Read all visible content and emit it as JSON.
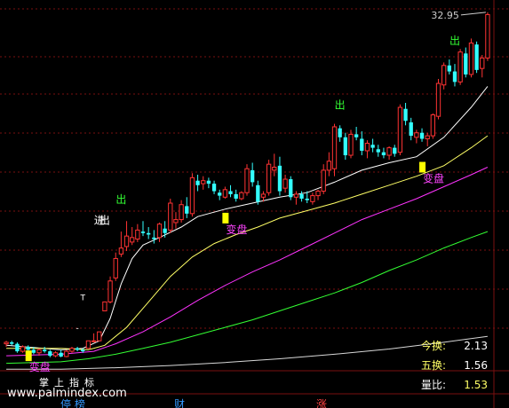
{
  "chart_data": {
    "type": "candlestick",
    "price_max_label": "32.95",
    "ylim": [
      9.0,
      33.3
    ],
    "up_color": "#ff3333",
    "down_color": "#33ffff",
    "bg_color": "#000000",
    "grid_color": "#7a1010",
    "candles": [
      [
        10.8,
        11.0,
        10.6,
        10.9
      ],
      [
        10.9,
        11.0,
        10.7,
        10.8
      ],
      [
        10.8,
        10.9,
        10.2,
        10.3
      ],
      [
        10.3,
        10.7,
        10.2,
        10.6
      ],
      [
        10.6,
        10.7,
        10.3,
        10.4
      ],
      [
        10.4,
        10.6,
        10.1,
        10.2
      ],
      [
        10.2,
        10.5,
        10.0,
        10.4
      ],
      [
        10.4,
        10.6,
        10.2,
        10.3
      ],
      [
        10.3,
        10.4,
        9.9,
        10.0
      ],
      [
        10.0,
        10.3,
        9.9,
        10.2
      ],
      [
        10.2,
        10.4,
        9.9,
        9.95
      ],
      [
        9.95,
        10.4,
        9.9,
        10.3
      ],
      [
        10.3,
        10.6,
        10.2,
        10.5
      ],
      [
        10.5,
        10.6,
        10.3,
        10.4
      ],
      [
        10.4,
        10.5,
        10.2,
        10.3
      ],
      [
        10.5,
        11.0,
        10.5,
        11.0
      ],
      [
        11.0,
        11.5,
        10.9,
        11.0
      ],
      [
        11.0,
        11.6,
        11.0,
        11.6
      ],
      [
        13.0,
        13.6,
        13.0,
        13.6
      ],
      [
        13.6,
        15.3,
        13.5,
        15.0
      ],
      [
        15.2,
        16.9,
        15.0,
        16.5
      ],
      [
        16.8,
        18.3,
        16.6,
        17.2
      ],
      [
        17.3,
        19.0,
        17.0,
        18.0
      ],
      [
        17.6,
        18.6,
        17.4,
        17.9
      ],
      [
        17.8,
        18.8,
        17.6,
        18.4
      ],
      [
        18.3,
        19.0,
        18.0,
        18.2
      ],
      [
        18.2,
        18.6,
        17.8,
        18.1
      ],
      [
        17.9,
        18.4,
        17.5,
        17.8
      ],
      [
        17.9,
        18.9,
        17.6,
        18.8
      ],
      [
        18.5,
        19.0,
        17.9,
        18.2
      ],
      [
        18.4,
        20.5,
        18.2,
        20.2
      ],
      [
        18.9,
        19.6,
        18.5,
        19.1
      ],
      [
        19.1,
        20.4,
        18.9,
        20.1
      ],
      [
        20.0,
        20.6,
        19.2,
        19.5
      ],
      [
        19.5,
        22.2,
        19.3,
        21.9
      ],
      [
        21.7,
        22.1,
        21.0,
        21.4
      ],
      [
        21.5,
        22.0,
        21.1,
        21.7
      ],
      [
        21.7,
        21.9,
        21.2,
        21.5
      ],
      [
        21.5,
        21.7,
        20.8,
        21.0
      ],
      [
        20.9,
        21.1,
        20.4,
        20.7
      ],
      [
        20.6,
        21.3,
        20.5,
        21.1
      ],
      [
        21.0,
        21.4,
        20.6,
        20.8
      ],
      [
        20.8,
        21.1,
        20.3,
        20.5
      ],
      [
        20.5,
        21.0,
        20.4,
        20.9
      ],
      [
        20.9,
        22.8,
        20.7,
        22.5
      ],
      [
        22.4,
        22.9,
        21.3,
        21.6
      ],
      [
        21.4,
        21.7,
        20.1,
        20.3
      ],
      [
        20.6,
        21.0,
        20.3,
        20.8
      ],
      [
        20.9,
        23.1,
        20.7,
        22.8
      ],
      [
        22.4,
        23.5,
        22.0,
        22.6
      ],
      [
        22.7,
        23.3,
        20.7,
        21.0
      ],
      [
        21.2,
        22.1,
        20.9,
        21.8
      ],
      [
        21.8,
        22.0,
        20.4,
        20.6
      ],
      [
        20.6,
        21.0,
        20.1,
        20.8
      ],
      [
        20.8,
        21.0,
        20.3,
        20.5
      ],
      [
        20.5,
        21.0,
        20.2,
        20.4
      ],
      [
        20.3,
        20.9,
        20.1,
        20.7
      ],
      [
        20.7,
        21.1,
        20.4,
        21.0
      ],
      [
        21.0,
        22.8,
        20.8,
        22.4
      ],
      [
        22.4,
        23.6,
        22.0,
        23.0
      ],
      [
        22.5,
        25.5,
        22.0,
        25.3
      ],
      [
        25.2,
        25.4,
        24.3,
        24.6
      ],
      [
        24.6,
        24.9,
        23.1,
        23.4
      ],
      [
        23.4,
        25.1,
        23.2,
        24.8
      ],
      [
        24.8,
        25.3,
        24.4,
        24.6
      ],
      [
        24.5,
        25.0,
        23.4,
        23.7
      ],
      [
        23.7,
        24.4,
        23.2,
        24.2
      ],
      [
        24.1,
        24.5,
        23.6,
        23.9
      ],
      [
        23.8,
        24.1,
        23.3,
        23.6
      ],
      [
        23.6,
        23.9,
        23.2,
        23.4
      ],
      [
        23.4,
        24.0,
        23.1,
        23.9
      ],
      [
        23.9,
        24.1,
        23.3,
        23.5
      ],
      [
        23.6,
        26.8,
        23.4,
        26.6
      ],
      [
        26.5,
        26.9,
        25.4,
        25.7
      ],
      [
        25.6,
        25.9,
        24.4,
        24.7
      ],
      [
        24.6,
        25.1,
        24.2,
        24.9
      ],
      [
        24.9,
        25.2,
        24.3,
        24.5
      ],
      [
        24.5,
        24.9,
        24.0,
        24.7
      ],
      [
        24.7,
        26.2,
        24.5,
        26.1
      ],
      [
        26.0,
        28.5,
        25.8,
        28.2
      ],
      [
        28.1,
        29.6,
        27.8,
        29.4
      ],
      [
        29.4,
        29.8,
        28.8,
        29.0
      ],
      [
        29.0,
        29.5,
        28.0,
        28.3
      ],
      [
        28.3,
        30.5,
        28.1,
        30.3
      ],
      [
        30.2,
        30.6,
        28.6,
        28.8
      ],
      [
        28.8,
        31.2,
        28.6,
        30.9
      ],
      [
        30.8,
        31.0,
        28.9,
        29.1
      ],
      [
        29.2,
        30.1,
        28.6,
        29.9
      ],
      [
        29.9,
        32.95,
        29.7,
        32.8
      ]
    ],
    "ma_lines": [
      {
        "color": "#ffffff",
        "points": [
          [
            0,
            10.7
          ],
          [
            10,
            10.4
          ],
          [
            14,
            10.5
          ],
          [
            17,
            11.0
          ],
          [
            19,
            12.5
          ],
          [
            21,
            14.8
          ],
          [
            23,
            16.5
          ],
          [
            25,
            17.4
          ],
          [
            28,
            17.9
          ],
          [
            32,
            18.6
          ],
          [
            35,
            19.3
          ],
          [
            40,
            19.8
          ],
          [
            45,
            20.2
          ],
          [
            50,
            20.6
          ],
          [
            55,
            20.9
          ],
          [
            60,
            21.6
          ],
          [
            65,
            22.4
          ],
          [
            70,
            22.9
          ],
          [
            75,
            23.3
          ],
          [
            80,
            24.6
          ],
          [
            85,
            26.6
          ],
          [
            88,
            28.0
          ]
        ]
      },
      {
        "color": "#ffff66",
        "points": [
          [
            0,
            10.5
          ],
          [
            10,
            10.5
          ],
          [
            15,
            10.4
          ],
          [
            18,
            10.7
          ],
          [
            22,
            11.9
          ],
          [
            26,
            13.6
          ],
          [
            30,
            15.3
          ],
          [
            34,
            16.6
          ],
          [
            38,
            17.5
          ],
          [
            42,
            18.1
          ],
          [
            46,
            18.6
          ],
          [
            50,
            19.2
          ],
          [
            55,
            19.7
          ],
          [
            60,
            20.2
          ],
          [
            65,
            20.8
          ],
          [
            70,
            21.4
          ],
          [
            75,
            22.0
          ],
          [
            80,
            22.7
          ],
          [
            85,
            23.9
          ],
          [
            88,
            24.7
          ]
        ]
      },
      {
        "color": "#ff33ff",
        "points": [
          [
            0,
            10.0
          ],
          [
            10,
            10.1
          ],
          [
            16,
            10.3
          ],
          [
            20,
            10.8
          ],
          [
            25,
            11.6
          ],
          [
            30,
            12.6
          ],
          [
            35,
            13.7
          ],
          [
            40,
            14.7
          ],
          [
            45,
            15.6
          ],
          [
            50,
            16.4
          ],
          [
            55,
            17.3
          ],
          [
            60,
            18.2
          ],
          [
            65,
            19.1
          ],
          [
            70,
            19.8
          ],
          [
            75,
            20.5
          ],
          [
            80,
            21.3
          ],
          [
            85,
            22.1
          ],
          [
            88,
            22.6
          ]
        ]
      },
      {
        "color": "#33ff33",
        "points": [
          [
            0,
            9.5
          ],
          [
            10,
            9.6
          ],
          [
            15,
            9.8
          ],
          [
            20,
            10.1
          ],
          [
            25,
            10.5
          ],
          [
            30,
            10.9
          ],
          [
            35,
            11.4
          ],
          [
            40,
            11.9
          ],
          [
            45,
            12.4
          ],
          [
            50,
            13.0
          ],
          [
            55,
            13.6
          ],
          [
            60,
            14.2
          ],
          [
            65,
            14.9
          ],
          [
            70,
            15.7
          ],
          [
            75,
            16.4
          ],
          [
            80,
            17.2
          ],
          [
            85,
            17.9
          ],
          [
            88,
            18.3
          ]
        ]
      },
      {
        "color": "#d8d8d8",
        "points": [
          [
            0,
            9.1
          ],
          [
            10,
            9.1
          ],
          [
            20,
            9.2
          ],
          [
            30,
            9.35
          ],
          [
            40,
            9.55
          ],
          [
            50,
            9.8
          ],
          [
            60,
            10.1
          ],
          [
            70,
            10.45
          ],
          [
            80,
            10.9
          ],
          [
            88,
            11.3
          ]
        ]
      }
    ],
    "signals": [
      {
        "text": "出",
        "i": 21,
        "price": 20.2,
        "color": "#33ff33"
      },
      {
        "text": "出",
        "i": 61,
        "price": 26.5,
        "color": "#33ff33"
      },
      {
        "text": "出",
        "i": 82,
        "price": 30.8,
        "color": "#33ff33"
      },
      {
        "text": "出",
        "i": 18,
        "price": 18.8,
        "color": "#ffffff"
      },
      {
        "text": "进",
        "i": 17,
        "price": 18.8,
        "color": "#ffffff"
      }
    ],
    "markers": [
      {
        "i": 4,
        "price": 10.0,
        "label": "变盘",
        "label_color": "#ff44ff"
      },
      {
        "i": 40,
        "price": 19.2,
        "label": "变盘",
        "label_color": "#ff44ff"
      },
      {
        "i": 76,
        "price": 22.6,
        "label": "变盘",
        "label_color": "#ff44ff"
      }
    ],
    "small_marks": [
      {
        "text": "T",
        "i": 14,
        "price": 13.7
      },
      {
        "text": "-",
        "i": 13,
        "price": 11.7
      }
    ],
    "stats": [
      {
        "label": "今换:",
        "value": "2.13",
        "label_color": "#ffff66",
        "value_color": "#ffffff"
      },
      {
        "label": "五换:",
        "value": "1.56",
        "label_color": "#ffff66",
        "value_color": "#ffffff"
      },
      {
        "label": "量比:",
        "value": "1.53",
        "label_color": "#ffffff",
        "value_color": "#ffff66"
      }
    ]
  },
  "caption": "掌上指标",
  "watermark": "www.palmindex.com",
  "tabs": [
    {
      "label": "停 榜",
      "color": "#3399ff"
    },
    {
      "label": "财",
      "color": "#3399ff"
    },
    {
      "label": "涨",
      "color": "#ff4444"
    }
  ]
}
